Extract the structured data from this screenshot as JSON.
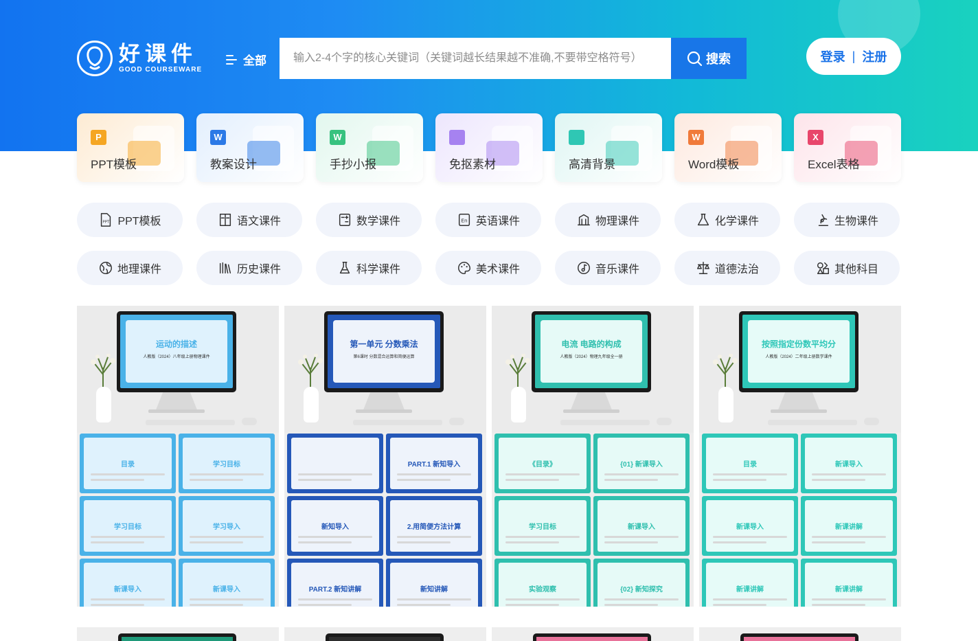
{
  "brand": {
    "name_cn": "好课件",
    "name_en": "GOOD COURSEWARE"
  },
  "header": {
    "all_label": "全部",
    "search_placeholder": "输入2-4个字的核心关键词（关键词越长结果越不准确,不要带空格符号）",
    "search_button": "搜索",
    "login": "登录",
    "separator": "|",
    "register": "注册"
  },
  "categories": [
    {
      "label": "PPT模板",
      "icon": "ppt-icon",
      "badge": "P",
      "color": "#f5a623",
      "bg": "#fdebd3"
    },
    {
      "label": "教案设计",
      "icon": "word-icon",
      "badge": "W",
      "color": "#2b79e6",
      "bg": "#e3effd"
    },
    {
      "label": "手抄小报",
      "icon": "word-green-icon",
      "badge": "W",
      "color": "#37c27f",
      "bg": "#e2f7ee"
    },
    {
      "label": "免抠素材",
      "icon": "mosaic-icon",
      "badge": "",
      "color": "#a682f0",
      "bg": "#ede6fd"
    },
    {
      "label": "高清背景",
      "icon": "image-icon",
      "badge": "",
      "color": "#2fc7b4",
      "bg": "#dff6f3"
    },
    {
      "label": "Word模板",
      "icon": "word-orange-icon",
      "badge": "W",
      "color": "#f07a3a",
      "bg": "#fde9df"
    },
    {
      "label": "Excel表格",
      "icon": "excel-icon",
      "badge": "X",
      "color": "#e8466b",
      "bg": "#fde4ea"
    }
  ],
  "subjects": [
    {
      "label": "PPT模板",
      "icon": "ppt-file-icon"
    },
    {
      "label": "语文课件",
      "icon": "chinese-book-icon"
    },
    {
      "label": "数学课件",
      "icon": "calculator-icon"
    },
    {
      "label": "英语课件",
      "icon": "english-icon"
    },
    {
      "label": "物理课件",
      "icon": "physics-icon"
    },
    {
      "label": "化学课件",
      "icon": "flask-icon"
    },
    {
      "label": "生物课件",
      "icon": "microscope-icon"
    },
    {
      "label": "地理课件",
      "icon": "globe-icon"
    },
    {
      "label": "历史课件",
      "icon": "history-books-icon"
    },
    {
      "label": "科学课件",
      "icon": "beaker-icon"
    },
    {
      "label": "美术课件",
      "icon": "palette-icon"
    },
    {
      "label": "音乐课件",
      "icon": "music-icon"
    },
    {
      "label": "道德法治",
      "icon": "scales-icon"
    },
    {
      "label": "其他科目",
      "icon": "shapes-icon"
    }
  ],
  "cards": [
    {
      "theme": "#4ab2e8",
      "screen_bg": "#dff2fd",
      "screen_title": "运动的描述",
      "screen_sub": "人教版（2024）八年级上册物理课件",
      "slides": [
        "目录",
        "学习目标",
        "学习目标",
        "学习导入",
        "新课导入",
        "新课导入"
      ]
    },
    {
      "theme": "#2558b8",
      "screen_bg": "#eef3fb",
      "screen_title": "第一单元 分数乘法",
      "screen_sub": "第6课时 分数混合运算和简便运算",
      "slides": [
        "",
        "PART.1 新知导入",
        "新知导入",
        "2.用简便方法计算",
        "PART.2 新知讲解",
        "新知讲解"
      ]
    },
    {
      "theme": "#2fbfae",
      "screen_bg": "#e6faf7",
      "screen_title": "电流 电路的构成",
      "screen_sub": "人教版（2024）物理九年级全一册",
      "slides": [
        "《目录》",
        "{01} 新课导入",
        "学习目标",
        "新课导入",
        "实验观察",
        "{02} 新知探究"
      ]
    },
    {
      "theme": "#2ec7b8",
      "screen_bg": "#e6fbf8",
      "screen_title": "按照指定份数平均分",
      "screen_sub": "人教版（2024）二年级上册数学课件",
      "slides": [
        "目录",
        "新课导入",
        "新课导入",
        "新课讲解",
        "新课讲解",
        "新课讲解"
      ]
    }
  ],
  "row2_colors": [
    "#1f9a7a",
    "#2d2d2d",
    "#e8739a",
    "#e8739a"
  ]
}
